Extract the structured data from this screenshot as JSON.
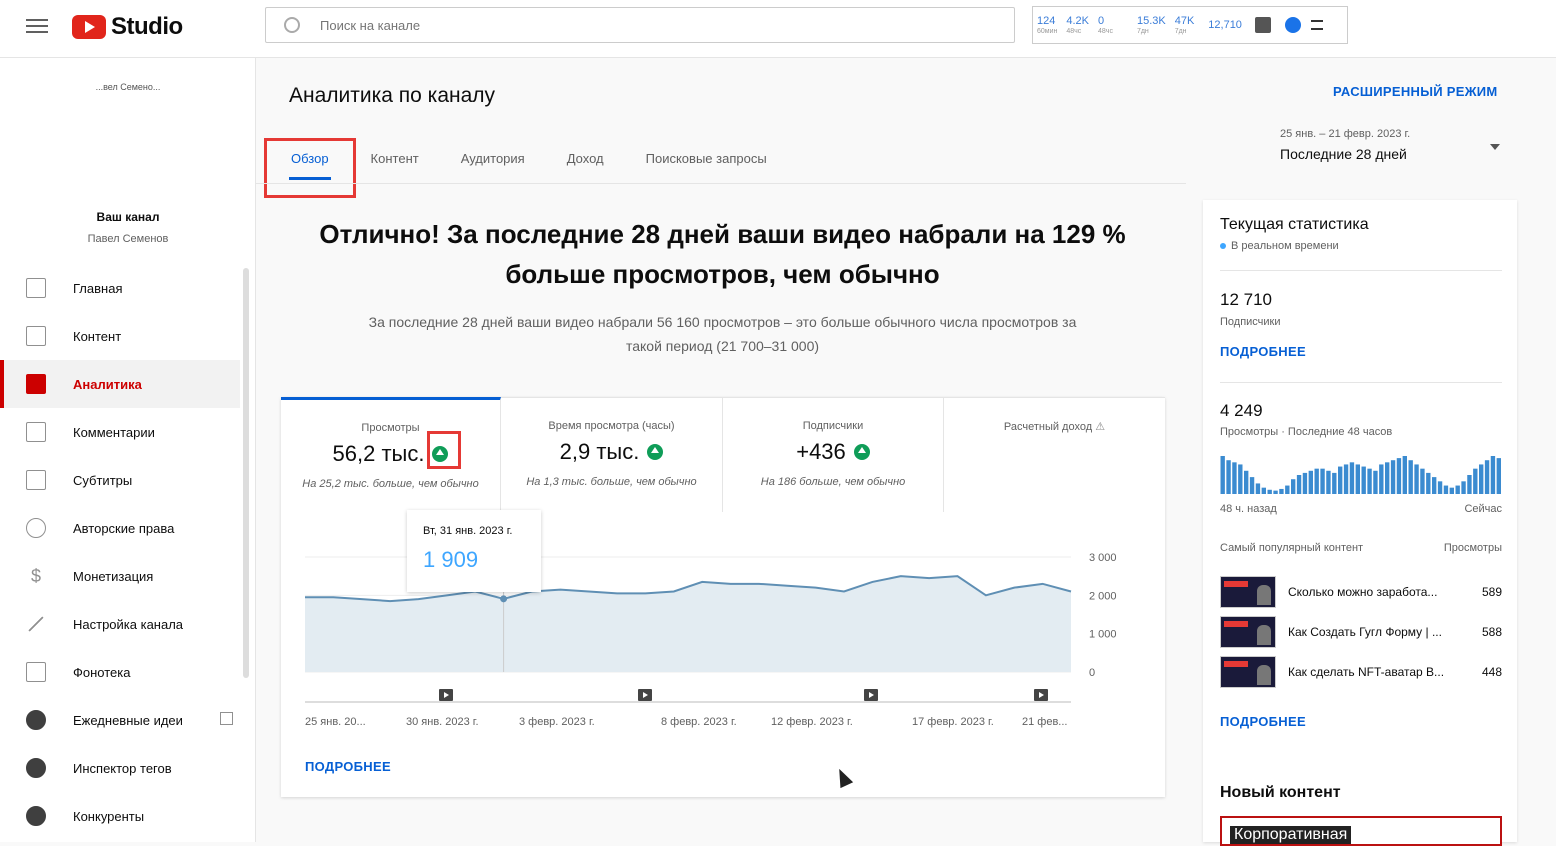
{
  "topbar": {
    "logo_text": "Studio",
    "search_placeholder": "Поиск на канале",
    "ext_stats": [
      {
        "value": "124",
        "sub": "60мин"
      },
      {
        "value": "4.2K",
        "sub": "48чс"
      },
      {
        "value": "0",
        "sub": "48чс"
      },
      {
        "value": "15.3K",
        "sub": "7дн"
      },
      {
        "value": "47K",
        "sub": "7дн"
      },
      {
        "value": "12,710",
        "sub": ""
      }
    ]
  },
  "sidebar": {
    "channel_tiny": "...вел Семено...",
    "channel_label": "Ваш канал",
    "channel_name": "Павел Семенов",
    "items": [
      {
        "label": "Главная",
        "icon": "dashboard-icon"
      },
      {
        "label": "Контент",
        "icon": "content-icon"
      },
      {
        "label": "Аналитика",
        "icon": "analytics-icon"
      },
      {
        "label": "Комментарии",
        "icon": "comments-icon"
      },
      {
        "label": "Субтитры",
        "icon": "subtitles-icon"
      },
      {
        "label": "Авторские права",
        "icon": "copyright-icon"
      },
      {
        "label": "Монетизация",
        "icon": "dollar-icon"
      },
      {
        "label": "Настройка канала",
        "icon": "magic-wand-icon"
      },
      {
        "label": "Фонотека",
        "icon": "audio-library-icon"
      },
      {
        "label": "Ежедневные идеи",
        "icon": "vidiq-icon"
      },
      {
        "label": "Инспектор тегов",
        "icon": "vidiq-icon"
      },
      {
        "label": "Конкуренты",
        "icon": "vidiq-icon"
      }
    ]
  },
  "main": {
    "title": "Аналитика по каналу",
    "advanced_mode": "РАСШИРЕННЫЙ РЕЖИМ",
    "tabs": [
      "Обзор",
      "Контент",
      "Аудитория",
      "Доход",
      "Поисковые запросы"
    ],
    "range_dates": "25 янв. – 21 февр. 2023 г.",
    "range_label": "Последние 28 дней",
    "headline": "Отлично! За последние 28 дней ваши видео набрали на 129 % больше просмотров, чем обычно",
    "subline": "За последние 28 дней ваши видео набрали 56 160 просмотров – это больше обычного числа просмотров за такой период (21 700–31 000)",
    "metrics": [
      {
        "label": "Просмотры",
        "value": "56,2 тыс.",
        "note": "На 25,2 тыс. больше, чем обычно"
      },
      {
        "label": "Время просмотра (часы)",
        "value": "2,9 тыс.",
        "note": "На 1,3 тыс. больше, чем обычно"
      },
      {
        "label": "Подписчики",
        "value": "+436",
        "note": "На 186 больше, чем обычно"
      },
      {
        "label": "Расчетный доход",
        "value": "",
        "note": ""
      }
    ],
    "tooltip": {
      "date": "Вт, 31 янв. 2023 г.",
      "value": "1 909"
    },
    "more_label": "ПОДРОБНЕЕ"
  },
  "chart_data": {
    "type": "area",
    "x": [
      "25 янв. 20...",
      "30 янв. 2023 г.",
      "3 февр. 2023 г.",
      "8 февр. 2023 г.",
      "12 февр. 2023 г.",
      "17 февр. 2023 г.",
      "21 фев..."
    ],
    "values": [
      1950,
      1950,
      1900,
      1850,
      1900,
      2000,
      2100,
      1909,
      2100,
      2150,
      2100,
      2050,
      2050,
      2100,
      2350,
      2300,
      2300,
      2250,
      2200,
      2100,
      2350,
      2500,
      2450,
      2500,
      2000,
      2200,
      2300,
      2100
    ],
    "ylim": [
      0,
      3000
    ],
    "yticks": [
      "3 000",
      "2 000",
      "1 000",
      "0"
    ],
    "colors": {
      "line": "#5f8fb4",
      "fill": "#e3ecf2"
    }
  },
  "right_panel": {
    "title": "Текущая статистика",
    "live": "В реальном времени",
    "subs_value": "12 710",
    "subs_label": "Подписчики",
    "more": "ПОДРОБНЕЕ",
    "views_value": "4 249",
    "views_label": "Просмотры · Последние 48 часов",
    "hist_start": "48 ч. назад",
    "hist_end": "Сейчас",
    "top_label": "Самый популярный контент",
    "top_col": "Просмотры",
    "top_videos": [
      {
        "title": "Сколько можно заработа...",
        "views": "589"
      },
      {
        "title": "Как Создать Гугл Форму | ...",
        "views": "588"
      },
      {
        "title": "Как сделать NFT-аватар В...",
        "views": "448"
      }
    ],
    "more2": "ПОДРОБНЕЕ",
    "new_content": "Новый контент",
    "new_thumb_text": "Корпоративная",
    "hourly_views": [
      90,
      80,
      75,
      70,
      55,
      40,
      25,
      15,
      10,
      8,
      12,
      20,
      35,
      45,
      50,
      55,
      60,
      60,
      55,
      50,
      65,
      70,
      75,
      70,
      65,
      60,
      55,
      70,
      75,
      80,
      85,
      90,
      80,
      70,
      60,
      50,
      40,
      30,
      20,
      15,
      20,
      30,
      45,
      60,
      70,
      80,
      90,
      85
    ]
  }
}
